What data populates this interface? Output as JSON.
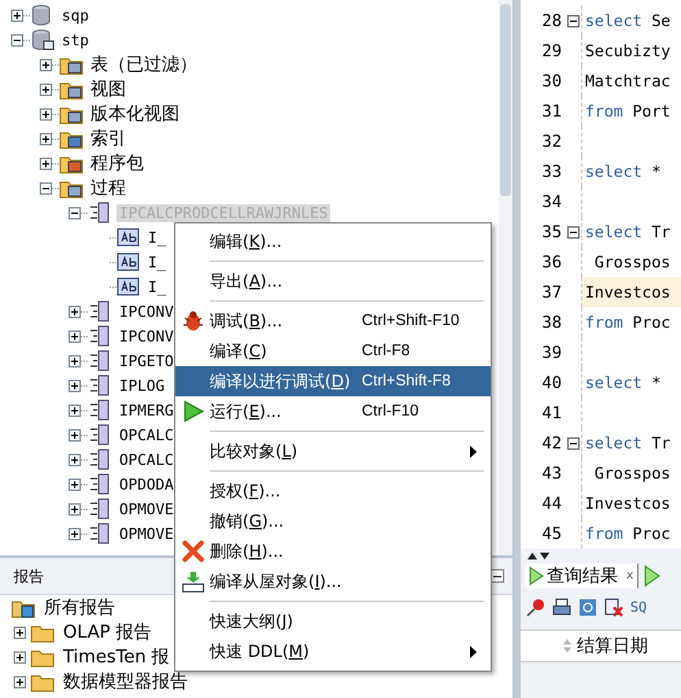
{
  "tree": [
    {
      "label": "sqp",
      "kind": "db",
      "expanded": false,
      "selected": false
    },
    {
      "label": "stp",
      "kind": "schema",
      "expanded": true,
      "selected": false,
      "children": [
        {
          "label": "表（已过滤）",
          "kind": "table-folder",
          "expanded": false,
          "selected": false
        },
        {
          "label": "视图",
          "kind": "view-folder",
          "expanded": false,
          "selected": false
        },
        {
          "label": "版本化视图",
          "kind": "view-folder",
          "expanded": false,
          "selected": false
        },
        {
          "label": "索引",
          "kind": "index-folder",
          "expanded": false,
          "selected": false
        },
        {
          "label": "程序包",
          "kind": "package-folder",
          "expanded": false,
          "selected": false
        },
        {
          "label": "过程",
          "kind": "proc-folder",
          "expanded": true,
          "selected": false,
          "children": [
            {
              "label": "IPCALCPRODCELLRAWJRNLES",
              "kind": "proc",
              "expanded": true,
              "selected": true,
              "children": [
                {
                  "label": "I_",
                  "kind": "param",
                  "selected": false
                },
                {
                  "label": "I_",
                  "kind": "param",
                  "selected": false
                },
                {
                  "label": "I_",
                  "kind": "param",
                  "selected": false
                }
              ]
            },
            {
              "label": "IPCONV",
              "kind": "proc",
              "expanded": false,
              "selected": false
            },
            {
              "label": "IPCONV",
              "kind": "proc",
              "expanded": false,
              "selected": false
            },
            {
              "label": "IPGETO",
              "kind": "proc",
              "expanded": false,
              "selected": false
            },
            {
              "label": "IPLOG",
              "kind": "proc",
              "expanded": false,
              "selected": false
            },
            {
              "label": "IPMERG",
              "kind": "proc",
              "expanded": false,
              "selected": false
            },
            {
              "label": "OPCALC",
              "kind": "proc",
              "expanded": false,
              "selected": false
            },
            {
              "label": "OPCALC",
              "kind": "proc",
              "expanded": false,
              "selected": false
            },
            {
              "label": "OPDODA",
              "kind": "proc",
              "expanded": false,
              "selected": false
            },
            {
              "label": "OPMOVE",
              "kind": "proc",
              "expanded": false,
              "selected": false
            },
            {
              "label": "OPMOVE",
              "kind": "proc",
              "expanded": false,
              "selected": false
            }
          ]
        }
      ]
    }
  ],
  "reports": {
    "title": "报告",
    "items": [
      {
        "label": "所有报告",
        "kind": "reports-root",
        "expanded": true,
        "children": [
          {
            "label": "OLAP 报告",
            "kind": "folder",
            "expanded": false
          },
          {
            "label": "TimesTen 报",
            "kind": "folder",
            "expanded": false
          },
          {
            "label": "数据模型器报告",
            "kind": "folder",
            "expanded": false
          }
        ]
      }
    ]
  },
  "editor": {
    "lines": [
      {
        "number": "28",
        "fold": true,
        "highlighted": false,
        "tokens": [
          {
            "text": "select",
            "kind": "keyword"
          },
          {
            "text": " Se",
            "kind": "plain"
          }
        ]
      },
      {
        "number": "29",
        "fold": false,
        "highlighted": false,
        "tokens": [
          {
            "text": "Secubizty",
            "kind": "plain"
          }
        ]
      },
      {
        "number": "30",
        "fold": false,
        "highlighted": false,
        "tokens": [
          {
            "text": "Matchtrac",
            "kind": "plain"
          }
        ]
      },
      {
        "number": "31",
        "fold": false,
        "highlighted": false,
        "tokens": [
          {
            "text": "from",
            "kind": "keyword"
          },
          {
            "text": " Port",
            "kind": "plain"
          }
        ]
      },
      {
        "number": "32",
        "fold": false,
        "highlighted": false
      },
      {
        "number": "33",
        "fold": false,
        "highlighted": false,
        "tokens": [
          {
            "text": "select",
            "kind": "keyword"
          },
          {
            "text": " *",
            "kind": "plain"
          }
        ]
      },
      {
        "number": "34",
        "fold": false,
        "highlighted": false
      },
      {
        "number": "35",
        "fold": true,
        "highlighted": false,
        "tokens": [
          {
            "text": "select",
            "kind": "keyword"
          },
          {
            "text": " Tr",
            "kind": "plain"
          }
        ]
      },
      {
        "number": "36",
        "fold": false,
        "highlighted": false,
        "tokens": [
          {
            "text": " Grosspos",
            "kind": "plain"
          }
        ]
      },
      {
        "number": "37",
        "fold": false,
        "highlighted": true,
        "tokens": [
          {
            "text": "Investcos",
            "kind": "plain"
          }
        ]
      },
      {
        "number": "38",
        "fold": false,
        "highlighted": false,
        "tokens": [
          {
            "text": "from",
            "kind": "keyword"
          },
          {
            "text": " Proc",
            "kind": "plain"
          }
        ]
      },
      {
        "number": "39",
        "fold": false,
        "highlighted": false
      },
      {
        "number": "40",
        "fold": false,
        "highlighted": false,
        "tokens": [
          {
            "text": "select",
            "kind": "keyword"
          },
          {
            "text": " *",
            "kind": "plain"
          }
        ]
      },
      {
        "number": "41",
        "fold": false,
        "highlighted": false
      },
      {
        "number": "42",
        "fold": true,
        "highlighted": false,
        "tokens": [
          {
            "text": "select",
            "kind": "keyword"
          },
          {
            "text": " Tr",
            "kind": "plain"
          }
        ]
      },
      {
        "number": "43",
        "fold": false,
        "highlighted": false,
        "tokens": [
          {
            "text": " Grosspos",
            "kind": "plain"
          }
        ]
      },
      {
        "number": "44",
        "fold": false,
        "highlighted": false,
        "tokens": [
          {
            "text": "Investcos",
            "kind": "plain"
          }
        ]
      },
      {
        "number": "45",
        "fold": false,
        "highlighted": false,
        "tokens": [
          {
            "text": "from",
            "kind": "keyword"
          },
          {
            "text": " Proc",
            "kind": "plain"
          }
        ]
      }
    ]
  },
  "results": {
    "tabs": [
      {
        "label": "查询结果",
        "close": "x",
        "selected": true
      }
    ],
    "toolbar_text": "SQ",
    "column_header": "结算日期"
  },
  "context_menu": [
    {
      "kind": "plain",
      "before": "编辑(",
      "key": "K",
      "after": ")...",
      "selected": false
    },
    {
      "kind": "separator"
    },
    {
      "kind": "plain",
      "before": "导出(",
      "key": "A",
      "after": ")...",
      "selected": false
    },
    {
      "kind": "separator"
    },
    {
      "kind": "bug",
      "before": "调试(",
      "key": "B",
      "after": ")...",
      "shortcut": "Ctrl+Shift-F10",
      "selected": false
    },
    {
      "kind": "plain",
      "before": "编译(",
      "key": "C",
      "after": ")",
      "shortcut": "Ctrl-F8",
      "selected": false
    },
    {
      "kind": "plain",
      "before": "编译以进行调试(",
      "key": "D",
      "after": ")",
      "shortcut": "Ctrl+Shift-F8",
      "selected": true
    },
    {
      "kind": "run",
      "before": "运行(",
      "key": "E",
      "after": ")...",
      "shortcut": "Ctrl-F10",
      "selected": false
    },
    {
      "kind": "separator"
    },
    {
      "kind": "plain",
      "before": "比较对象(",
      "key": "L",
      "after": ")",
      "submenu": true,
      "selected": false
    },
    {
      "kind": "separator"
    },
    {
      "kind": "plain",
      "before": "授权(",
      "key": "F",
      "after": ")...",
      "selected": false
    },
    {
      "kind": "plain",
      "before": "撤销(",
      "key": "G",
      "after": ")...",
      "selected": false
    },
    {
      "kind": "delete",
      "before": "删除(",
      "key": "H",
      "after": ")...",
      "selected": false
    },
    {
      "kind": "compile",
      "before": "编译从屋对象(",
      "key": "I",
      "after": ")...",
      "selected": false
    },
    {
      "kind": "separator"
    },
    {
      "kind": "plain",
      "before": "快速大纲(",
      "key": "J",
      "after": ")",
      "selected": false
    },
    {
      "kind": "plain",
      "before": "快速 DDL(",
      "key": "M",
      "after": ")",
      "submenu": true,
      "selected": false
    }
  ]
}
